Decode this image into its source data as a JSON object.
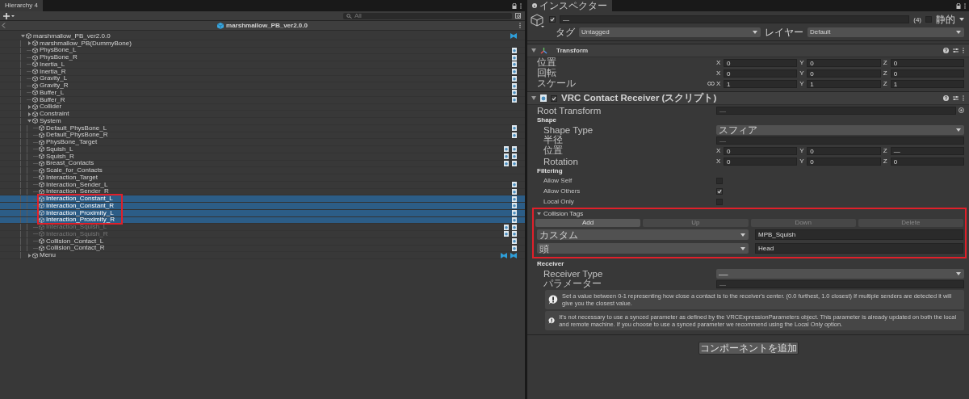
{
  "hierarchy": {
    "tab": "Hierarchy 4",
    "search": {
      "placeholder": "All"
    },
    "scene": {
      "title": "marshmallow_PB_ver2.0.0"
    },
    "tree": [
      {
        "name": "marshmallow_PB_ver2.0.0",
        "expanded": true,
        "selected": false,
        "disabled": false,
        "outlined": false,
        "components": [
          {
            "kind": "bowtie"
          }
        ],
        "children": [
          {
            "name": "marshmallow_PB(DummyBone)",
            "expanded": false,
            "selected": false,
            "disabled": false,
            "outlined": false
          },
          {
            "name": "PhysBone_L",
            "selected": false,
            "disabled": false,
            "outlined": false,
            "components": [
              {
                "kind": "script"
              }
            ]
          },
          {
            "name": "PhysBone_R",
            "selected": false,
            "disabled": false,
            "outlined": false,
            "components": [
              {
                "kind": "script"
              }
            ]
          },
          {
            "name": "Inertia_L",
            "selected": false,
            "disabled": false,
            "outlined": false,
            "components": [
              {
                "kind": "script"
              }
            ]
          },
          {
            "name": "Inertia_R",
            "selected": false,
            "disabled": false,
            "outlined": false,
            "components": [
              {
                "kind": "script"
              }
            ]
          },
          {
            "name": "Gravity_L",
            "selected": false,
            "disabled": false,
            "outlined": false,
            "components": [
              {
                "kind": "script"
              }
            ]
          },
          {
            "name": "Gravity_R",
            "selected": false,
            "disabled": false,
            "outlined": false,
            "components": [
              {
                "kind": "script"
              }
            ]
          },
          {
            "name": "Buffer_L",
            "selected": false,
            "disabled": false,
            "outlined": false,
            "components": [
              {
                "kind": "script"
              }
            ]
          },
          {
            "name": "Buffer_R",
            "selected": false,
            "disabled": false,
            "outlined": false,
            "components": [
              {
                "kind": "script"
              }
            ]
          },
          {
            "name": "Collider",
            "expanded": false,
            "selected": false,
            "disabled": false,
            "outlined": false
          },
          {
            "name": "Constraint",
            "expanded": false,
            "selected": false,
            "disabled": false,
            "outlined": false
          },
          {
            "name": "System",
            "expanded": true,
            "selected": false,
            "disabled": false,
            "outlined": false,
            "children": [
              {
                "name": "Default_PhysBone_L",
                "selected": false,
                "disabled": false,
                "outlined": false,
                "components": [
                  {
                    "kind": "script"
                  }
                ]
              },
              {
                "name": "Default_PhysBone_R",
                "selected": false,
                "disabled": false,
                "outlined": false,
                "components": [
                  {
                    "kind": "script"
                  }
                ]
              },
              {
                "name": "PhysBone_Target",
                "selected": false,
                "disabled": false,
                "outlined": false
              },
              {
                "name": "Squish_L",
                "selected": false,
                "disabled": false,
                "outlined": false,
                "components": [
                  {
                    "kind": "script"
                  },
                  {
                    "kind": "script"
                  }
                ]
              },
              {
                "name": "Squish_R",
                "selected": false,
                "disabled": false,
                "outlined": false,
                "components": [
                  {
                    "kind": "script"
                  },
                  {
                    "kind": "script"
                  }
                ]
              },
              {
                "name": "Breast_Contacts",
                "selected": false,
                "disabled": false,
                "outlined": false,
                "components": [
                  {
                    "kind": "script"
                  },
                  {
                    "kind": "script"
                  }
                ]
              },
              {
                "name": "Scale_for_Contacts",
                "selected": false,
                "disabled": false,
                "outlined": false
              },
              {
                "name": "Interaction_Target",
                "selected": false,
                "disabled": false,
                "outlined": false
              },
              {
                "name": "Interaction_Sender_L",
                "selected": false,
                "disabled": false,
                "outlined": false,
                "components": [
                  {
                    "kind": "script"
                  }
                ]
              },
              {
                "name": "Interaction_Sender_R",
                "selected": false,
                "disabled": false,
                "outlined": false,
                "components": [
                  {
                    "kind": "script"
                  }
                ]
              },
              {
                "name": "Interaction_Constant_L",
                "selected": true,
                "disabled": false,
                "outlined": true,
                "components": [
                  {
                    "kind": "script"
                  }
                ]
              },
              {
                "name": "Interaction_Constant_R",
                "selected": true,
                "disabled": false,
                "outlined": true,
                "components": [
                  {
                    "kind": "script"
                  }
                ]
              },
              {
                "name": "Interaction_Proximity_L",
                "selected": true,
                "disabled": false,
                "outlined": true,
                "components": [
                  {
                    "kind": "script"
                  }
                ]
              },
              {
                "name": "Interaction_Proximity_R",
                "selected": true,
                "disabled": false,
                "outlined": true,
                "components": [
                  {
                    "kind": "script"
                  }
                ]
              },
              {
                "name": "Interaction_Squish_L",
                "selected": false,
                "disabled": true,
                "outlined": false,
                "components": [
                  {
                    "kind": "script"
                  },
                  {
                    "kind": "script"
                  }
                ]
              },
              {
                "name": "Interaction_Squish_R",
                "selected": false,
                "disabled": true,
                "outlined": false,
                "components": [
                  {
                    "kind": "script"
                  },
                  {
                    "kind": "script"
                  }
                ]
              },
              {
                "name": "Collision_Contact_L",
                "selected": false,
                "disabled": false,
                "outlined": false,
                "components": [
                  {
                    "kind": "script"
                  }
                ]
              },
              {
                "name": "Collision_Contact_R",
                "selected": false,
                "disabled": false,
                "outlined": false,
                "components": [
                  {
                    "kind": "script"
                  }
                ]
              }
            ]
          },
          {
            "name": "Menu",
            "expanded": false,
            "selected": false,
            "disabled": false,
            "outlined": false,
            "components": [
              {
                "kind": "bowtie"
              },
              {
                "kind": "bowtie"
              }
            ]
          }
        ]
      }
    ]
  },
  "inspector": {
    "tab": "インスペクター",
    "object": {
      "active": true,
      "name": "—",
      "count": "(4)",
      "static": false,
      "static_label": "静的",
      "tag_label": "タグ",
      "tag": "Untagged",
      "layer_label": "レイヤー",
      "layer": "Default"
    },
    "transform": {
      "title": "Transform",
      "expanded": true,
      "rows": [
        {
          "label": "位置",
          "link": false,
          "values": [
            {
              "axis": "X",
              "value": "0"
            },
            {
              "axis": "Y",
              "value": "0"
            },
            {
              "axis": "Z",
              "value": "0"
            }
          ]
        },
        {
          "label": "回転",
          "link": false,
          "values": [
            {
              "axis": "X",
              "value": "0"
            },
            {
              "axis": "Y",
              "value": "0"
            },
            {
              "axis": "Z",
              "value": "0"
            }
          ]
        },
        {
          "label": "スケール",
          "link": true,
          "values": [
            {
              "axis": "X",
              "value": "1"
            },
            {
              "axis": "Y",
              "value": "1"
            },
            {
              "axis": "Z",
              "value": "1"
            }
          ]
        }
      ]
    },
    "receiver": {
      "title": "VRC Contact Receiver (スクリプト)",
      "enabled": true,
      "expanded": true,
      "rows": [
        {
          "kind": "object",
          "label": "Root Transform",
          "value": "—"
        },
        {
          "kind": "header",
          "label": "Shape"
        },
        {
          "kind": "dropdown",
          "label": "Shape Type",
          "value": "スフィア"
        },
        {
          "kind": "field",
          "label": "半径",
          "value": "—"
        },
        {
          "kind": "vector",
          "label": "位置",
          "values": [
            {
              "axis": "X",
              "value": "0"
            },
            {
              "axis": "Y",
              "value": "0"
            },
            {
              "axis": "Z",
              "value": "—"
            }
          ]
        },
        {
          "kind": "vector",
          "label": "Rotation",
          "values": [
            {
              "axis": "X",
              "value": "0"
            },
            {
              "axis": "Y",
              "value": "0"
            },
            {
              "axis": "Z",
              "value": "0"
            }
          ]
        },
        {
          "kind": "header",
          "label": "Filtering"
        },
        {
          "kind": "checkbox",
          "label": "Allow Self",
          "checked": false
        },
        {
          "kind": "checkbox",
          "label": "Allow Others",
          "checked": true
        },
        {
          "kind": "checkbox",
          "label": "Local Only",
          "checked": false
        },
        {
          "kind": "tags",
          "label": "Collision Tags",
          "expanded": true,
          "outlined": true,
          "buttons": [
            {
              "label": "Add",
              "disabled": false
            },
            {
              "label": "Up",
              "disabled": true
            },
            {
              "label": "Down",
              "disabled": true
            },
            {
              "label": "Delete",
              "disabled": true
            }
          ],
          "items": [
            {
              "type": "カスタム",
              "value": "MPB_Squish"
            },
            {
              "type": "頭",
              "value": "Head"
            }
          ]
        },
        {
          "kind": "header",
          "label": "Receiver"
        },
        {
          "kind": "dropdown",
          "label": "Receiver Type",
          "value": "—"
        },
        {
          "kind": "field",
          "label": "パラメーター",
          "value": "—"
        },
        {
          "kind": "help",
          "text": "Set a value between 0-1 representing how close a contact is to the receiver's center. (0.0 furthest, 1.0 closest)  If multiple senders are detected it will give you the closest value."
        },
        {
          "kind": "help",
          "text": "It's not necessary to use a synced parameter as defined by the VRCExpressionParameters object.  This parameter is already updated on both the local and remote machine.  If you choose to use a synced parameter we recommend using the Local Only option."
        }
      ]
    },
    "add_component": "コンポーネントを追加"
  }
}
